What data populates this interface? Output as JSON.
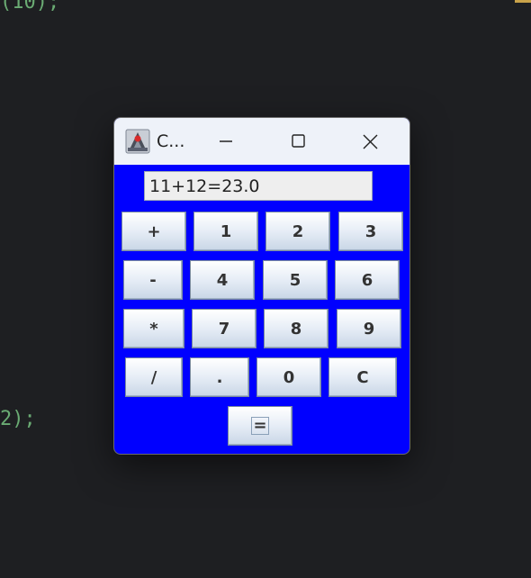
{
  "editor": {
    "code_top": "(10);",
    "code_mid": "2);"
  },
  "window": {
    "title": "C...",
    "icon": "java-app-icon"
  },
  "display": {
    "value": "11+12=23.0"
  },
  "keys": {
    "plus": "+",
    "one": "1",
    "two": "2",
    "three": "3",
    "minus": "-",
    "four": "4",
    "five": "5",
    "six": "6",
    "multiply": "*",
    "seven": "7",
    "eight": "8",
    "nine": "9",
    "divide": "/",
    "dot": ".",
    "zero": "0",
    "clear": "C",
    "equals": "="
  },
  "colors": {
    "panel_bg": "#0000ff",
    "titlebar_bg": "#eef2f9",
    "editor_bg": "#1e1f22",
    "code_green": "#6aab73"
  }
}
